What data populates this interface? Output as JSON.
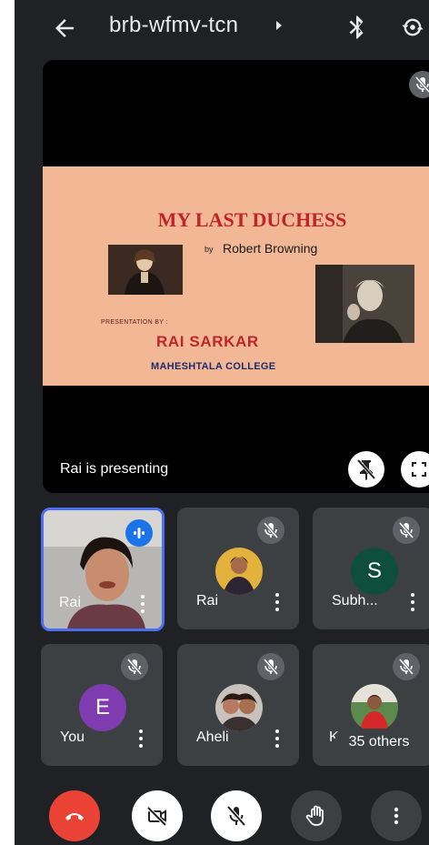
{
  "topbar": {
    "meeting_code": "brb-wfmv-tcn",
    "icons": [
      "back-arrow-icon",
      "caret-right-icon",
      "bluetooth-icon",
      "switch-camera-icon"
    ]
  },
  "presentation": {
    "slide": {
      "title": "MY LAST DUCHESS",
      "by": "by",
      "author": "Robert Browning",
      "presentation_by": "PRESENTATION BY :",
      "presenter": "RAI SARKAR",
      "college": "MAHESHTALA COLLEGE"
    },
    "presenting_label": "Rai is presenting",
    "icons": [
      "mic-off-icon",
      "pin-off-icon",
      "fullscreen-icon"
    ]
  },
  "participants": [
    {
      "name": "Rai",
      "avatar": "video",
      "state": "speaking",
      "colors": {
        "ring": "#4a6ff0",
        "speaking": "#1a73e8"
      }
    },
    {
      "name": "Rai",
      "avatar": "photo",
      "state": "muted"
    },
    {
      "name": "Subh...",
      "avatar": "S",
      "state": "muted",
      "colors": {
        "avatar": "#0d4f3c"
      }
    },
    {
      "name": "You",
      "avatar": "E",
      "state": "muted",
      "colors": {
        "avatar": "#7e3cb0"
      }
    },
    {
      "name": "Aheli",
      "avatar": "photo",
      "state": "muted"
    },
    {
      "name": "K",
      "avatar": "photo",
      "state": "muted"
    }
  ],
  "others_badge": "35 others",
  "controls": {
    "items": [
      "hang-up-icon",
      "camera-off-icon",
      "mic-off-icon",
      "raise-hand-icon",
      "more-vert-icon"
    ],
    "colors": {
      "hangup": "#ea4335",
      "light": "#ffffff",
      "dark": "#3c4043"
    }
  }
}
